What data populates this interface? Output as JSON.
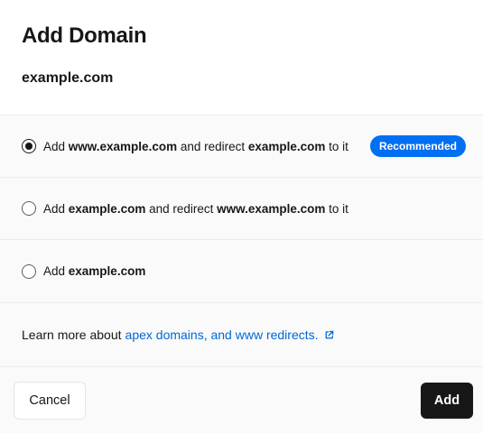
{
  "dialog": {
    "title": "Add Domain",
    "domain": "example.com"
  },
  "options": [
    {
      "checked": true,
      "parts": [
        "Add ",
        "www.example.com",
        " and redirect ",
        "example.com",
        " to it"
      ],
      "badge": "Recommended"
    },
    {
      "checked": false,
      "parts": [
        "Add ",
        "example.com",
        " and redirect ",
        "www.example.com",
        " to it"
      ]
    },
    {
      "checked": false,
      "parts": [
        "Add ",
        "example.com"
      ]
    }
  ],
  "learn_more": {
    "prefix": "Learn more about",
    "link_text": "apex domains, and www redirects.",
    "icon": "external-link-icon"
  },
  "footer": {
    "cancel_label": "Cancel",
    "add_label": "Add"
  },
  "colors": {
    "accent": "#0070f3",
    "link": "#0068d6",
    "primary_button": "#171717"
  }
}
